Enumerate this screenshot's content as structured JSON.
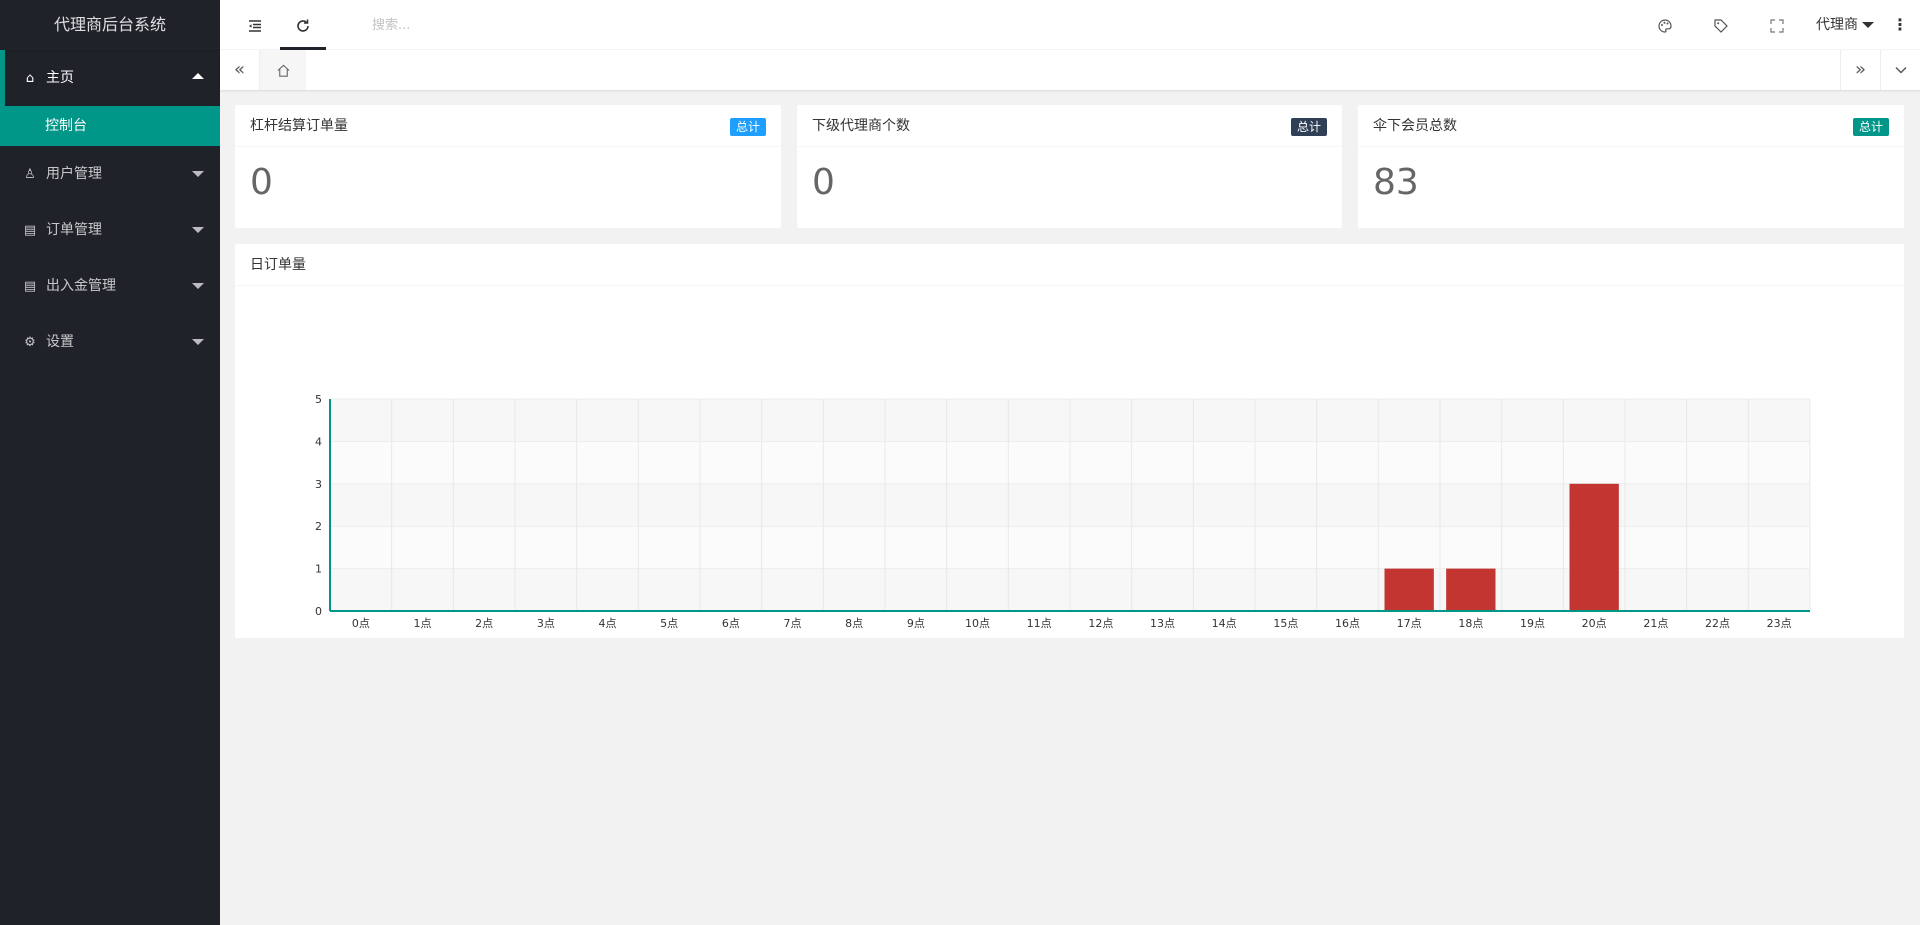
{
  "sidebar": {
    "title": "代理商后台系统",
    "menu": [
      {
        "label": "主页",
        "icon": "home-icon"
      },
      {
        "label": "用户管理",
        "icon": "user-icon"
      },
      {
        "label": "订单管理",
        "icon": "order-icon"
      },
      {
        "label": "出入金管理",
        "icon": "money-icon"
      },
      {
        "label": "设置",
        "icon": "gear-icon"
      }
    ],
    "submenu": {
      "label": "控制台"
    }
  },
  "header": {
    "search_placeholder": "搜索...",
    "user_label": "代理商"
  },
  "cards": [
    {
      "title": "杠杆结算订单量",
      "badge": "总计",
      "badge_color": "#1e9fff",
      "value": "0"
    },
    {
      "title": "下级代理商个数",
      "badge": "总计",
      "badge_color": "#2f4056",
      "value": "0"
    },
    {
      "title": "伞下会员总数",
      "badge": "总计",
      "badge_color": "#009688",
      "value": "83"
    }
  ],
  "chart_card": {
    "title": "日订单量"
  },
  "chart_data": {
    "type": "bar",
    "categories": [
      "0点",
      "1点",
      "2点",
      "3点",
      "4点",
      "5点",
      "6点",
      "7点",
      "8点",
      "9点",
      "10点",
      "11点",
      "12点",
      "13点",
      "14点",
      "15点",
      "16点",
      "17点",
      "18点",
      "19点",
      "20点",
      "21点",
      "22点",
      "23点"
    ],
    "values": [
      0,
      0,
      0,
      0,
      0,
      0,
      0,
      0,
      0,
      0,
      0,
      0,
      0,
      0,
      0,
      0,
      0,
      1,
      1,
      0,
      3,
      0,
      0,
      0
    ],
    "ylim": [
      0,
      5
    ],
    "yticks": [
      0,
      1,
      2,
      3,
      4,
      5
    ],
    "bar_color": "#c23531",
    "axis_color": "#009688",
    "grid": true
  }
}
